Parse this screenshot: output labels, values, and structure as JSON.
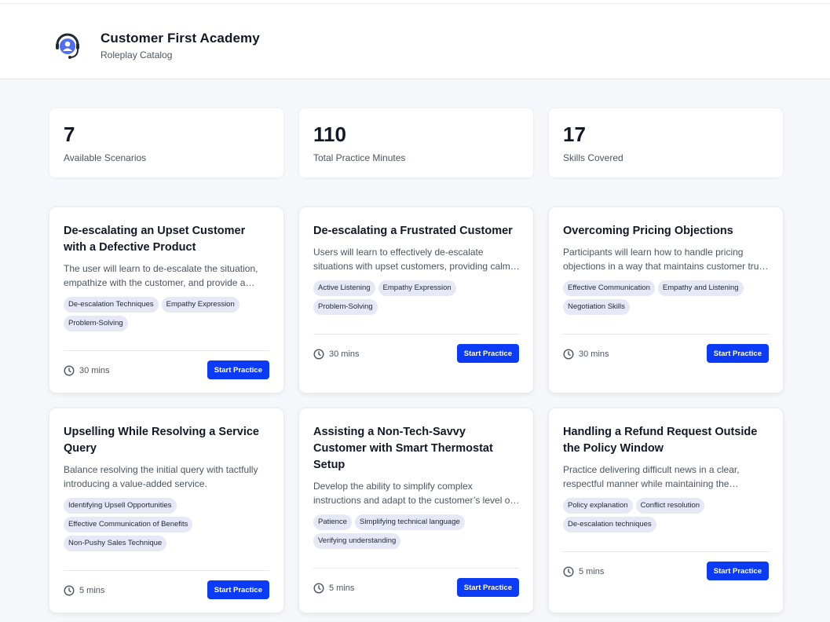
{
  "header": {
    "title": "Customer First Academy",
    "subtitle": "Roleplay Catalog",
    "logo_icon": "headset-user-icon"
  },
  "stats": [
    {
      "value": "7",
      "label": "Available Scenarios"
    },
    {
      "value": "110",
      "label": "Total Practice Minutes"
    },
    {
      "value": "17",
      "label": "Skills Covered"
    }
  ],
  "scenarios": [
    {
      "title": "De-escalating an Upset Customer with a Defective Product",
      "description": "The user will learn to de-escalate the situation, empathize with the customer, and provide a resolution for the defective product.",
      "tags": [
        "De-escalation Techniques",
        "Empathy Expression",
        "Problem-Solving"
      ],
      "duration": "30 mins",
      "button": "Start Practice"
    },
    {
      "title": "De-escalating a Frustrated Customer",
      "description": "Users will learn to effectively de-escalate situations with upset customers, providing calm and constructive responses.",
      "tags": [
        "Active Listening",
        "Empathy Expression",
        "Problem-Solving"
      ],
      "duration": "30 mins",
      "button": "Start Practice"
    },
    {
      "title": "Overcoming Pricing Objections",
      "description": "Participants will learn how to handle pricing objections in a way that maintains customer trust and value perception.",
      "tags": [
        "Effective Communication",
        "Empathy and Listening",
        "Negotiation Skills"
      ],
      "duration": "30 mins",
      "button": "Start Practice"
    },
    {
      "title": "Upselling While Resolving a Service Query",
      "description": "Balance resolving the initial query with tactfully introducing a value-added service.",
      "tags": [
        "Identifying Upsell Opportunities",
        "Effective Communication of Benefits",
        "Non-Pushy Sales Technique"
      ],
      "duration": "5 mins",
      "button": "Start Practice"
    },
    {
      "title": "Assisting a Non-Tech-Savvy Customer with Smart Thermostat Setup",
      "description": "Develop the ability to simplify complex instructions and adapt to the customer’s level of understanding.",
      "tags": [
        "Patience",
        "Simplifying technical language",
        "Verifying understanding"
      ],
      "duration": "5 mins",
      "button": "Start Practice"
    },
    {
      "title": "Handling a Refund Request Outside the Policy Window",
      "description": "Practice delivering difficult news in a clear, respectful manner while maintaining the customer relationship.",
      "tags": [
        "Policy explanation",
        "Conflict resolution",
        "De-escalation techniques"
      ],
      "duration": "5 mins",
      "button": "Start Practice"
    }
  ],
  "colors": {
    "accent": "#0b3bf6",
    "background": "#f5f7fa",
    "tag_bg": "#e6e8f5"
  }
}
